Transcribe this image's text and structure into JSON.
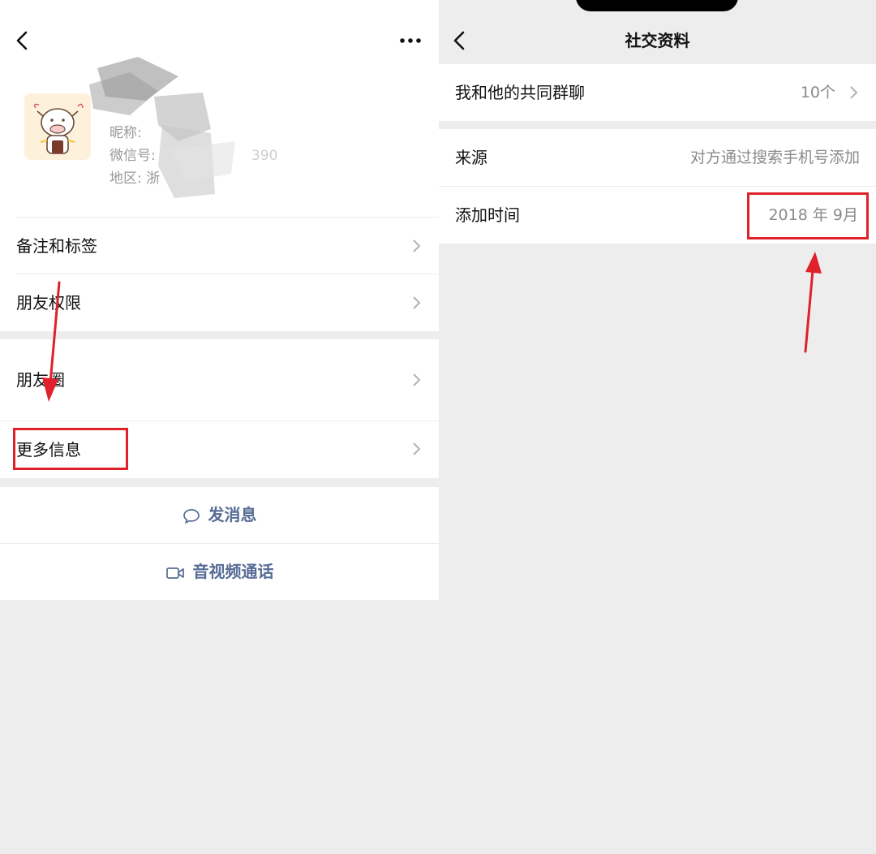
{
  "left_screen": {
    "profile": {
      "nickname_prefix": "昵称:",
      "wechat_id_prefix": "微信号:",
      "wechat_id_partial": "390",
      "region_prefix": "地区: 浙"
    },
    "menu": [
      {
        "label": "备注和标签"
      },
      {
        "label": "朋友权限"
      },
      {
        "label": "朋友圈"
      },
      {
        "label": "更多信息"
      }
    ],
    "actions": {
      "message": "发消息",
      "call": "音视频通话"
    }
  },
  "right_screen": {
    "title": "社交资料",
    "common_groups": {
      "label": "我和他的共同群聊",
      "value": "10个"
    },
    "source": {
      "label": "来源",
      "value": "对方通过搜索手机号添加"
    },
    "add_time": {
      "label": "添加时间",
      "value": "2018 年 9月"
    }
  },
  "colors": {
    "background": "#ededed",
    "link": "#576b95",
    "annotation": "#e0202a",
    "muted": "#8a8a8a"
  }
}
